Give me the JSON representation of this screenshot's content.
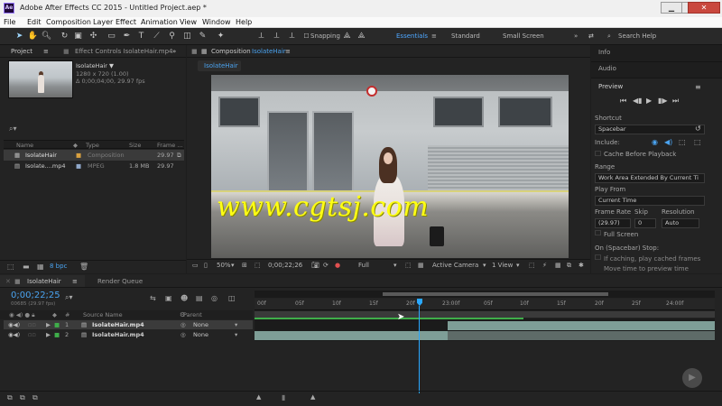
{
  "window": {
    "title": "Adobe After Effects CC 2015 - Untitled Project.aep *",
    "app_icon": "Ae"
  },
  "menu": [
    "File",
    "Edit",
    "Composition",
    "Layer",
    "Effect",
    "Animation",
    "View",
    "Window",
    "Help"
  ],
  "toolbar": {
    "snapping_label": "Snapping",
    "workspaces": [
      "Essentials",
      "Standard",
      "Small Screen"
    ],
    "search_help_placeholder": "Search Help"
  },
  "project_panel": {
    "tab_project": "Project",
    "tab_effect_controls": "Effect Controls IsolateHair.mp4",
    "selected_item_name": "IsolateHair ▼",
    "selected_item_res": "1280 x 720 (1.00)",
    "selected_item_duration": "Δ 0;00;04;00, 29.97 fps",
    "columns": [
      "Name",
      "Type",
      "Size",
      "Frame ..."
    ],
    "items": [
      {
        "name": "IsolateHair",
        "type": "Composition",
        "size": "",
        "frame": "29.97"
      },
      {
        "name": "Isolate....mp4",
        "type": "MPEG",
        "size": "1.8 MB",
        "frame": "29.97"
      }
    ],
    "bpc": "8 bpc"
  },
  "composition_panel": {
    "tab": "Composition",
    "tab_name": "IsolateHair",
    "subtab": "IsolateHair",
    "watermark": "www.cgtsj.com",
    "zoom": "50%",
    "timecode": "0;00;22;26",
    "resolution": "Full",
    "camera": "Active Camera",
    "view": "1 View"
  },
  "right_panel": {
    "info_tab": "Info",
    "audio_tab": "Audio",
    "preview_tab": "Preview",
    "shortcut_label": "Shortcut",
    "shortcut_value": "Spacebar",
    "include_label": "Include:",
    "cache_label": "Cache Before Playback",
    "range_label": "Range",
    "range_value": "Work Area Extended By Current Ti",
    "play_from_label": "Play From",
    "play_from_value": "Current Time",
    "frame_rate_label": "Frame Rate",
    "skip_label": "Skip",
    "resolution_label": "Resolution",
    "frame_rate_value": "(29.97)",
    "skip_value": "0",
    "resolution_value": "Auto",
    "full_screen_label": "Full Screen",
    "on_stop_label": "On (Spacebar) Stop:",
    "if_caching_label": "If caching, play cached frames",
    "move_time_label": "Move time to preview time"
  },
  "timeline": {
    "tab_comp": "IsolateHair",
    "tab_render": "Render Queue",
    "current_time": "0;00;22;25",
    "frame_info": "00685 (29.97 fps)",
    "col_num": "#",
    "col_source": "Source Name",
    "col_parent": "Parent",
    "ruler": [
      "00f",
      "05f",
      "10f",
      "15f",
      "20f",
      "25f",
      "23:00f",
      "05f",
      "10f",
      "15f",
      "20f",
      "25f",
      "24:00f"
    ],
    "layers": [
      {
        "num": "1",
        "name": "IsolateHair.mp4",
        "parent": "None"
      },
      {
        "num": "2",
        "name": "IsolateHair.mp4",
        "parent": "None"
      }
    ]
  },
  "colors": {
    "accent": "#4aa3f0",
    "playhead": "#2aa8ff",
    "layer_green": "#3fae4a",
    "layer_teal": "#7e9e97",
    "watermark": "#ffff14"
  }
}
